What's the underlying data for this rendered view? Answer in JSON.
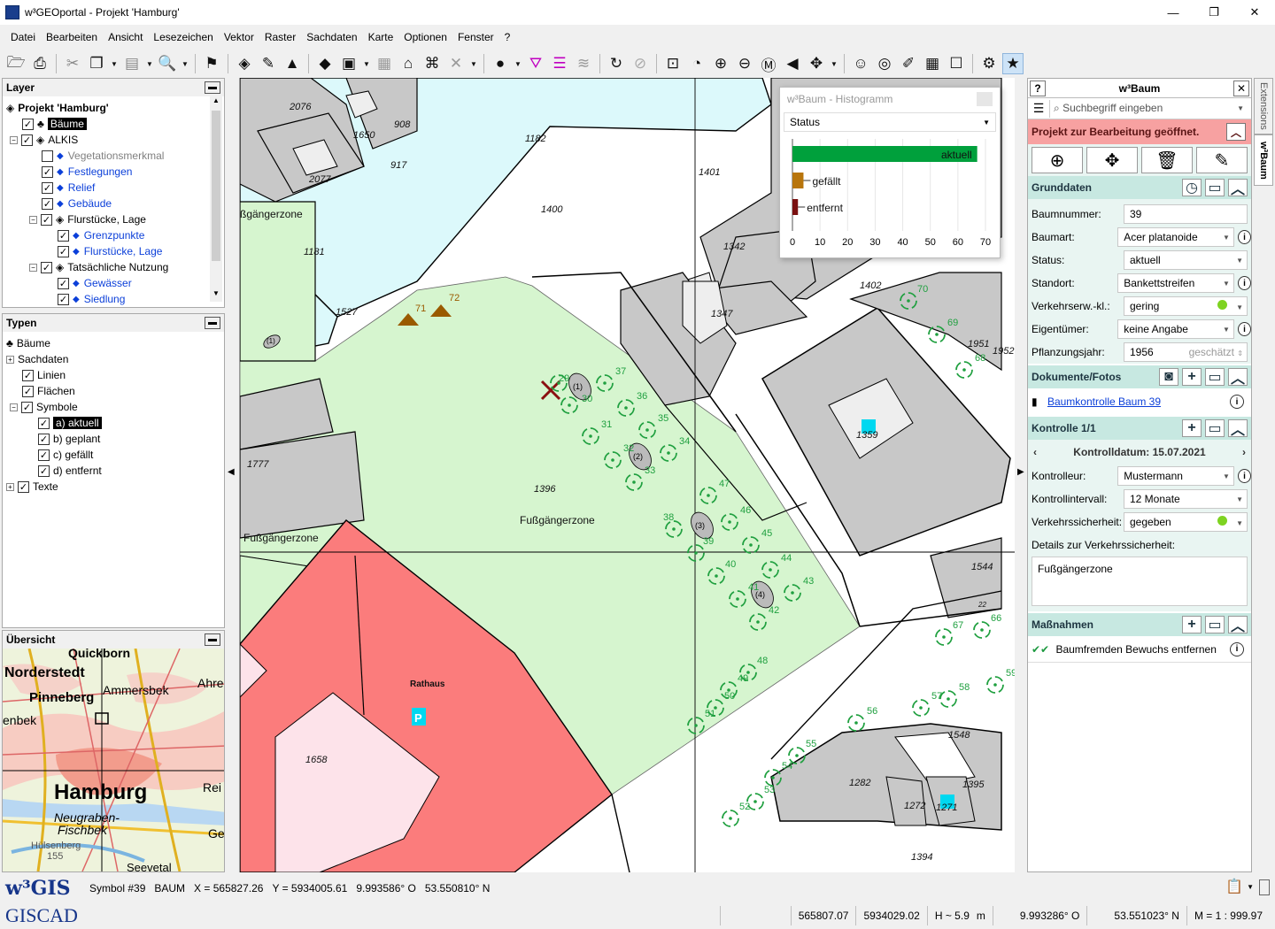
{
  "window": {
    "title": "w³GEOportal - Projekt 'Hamburg'",
    "minimize": "—",
    "maximize": "❐",
    "close": "✕"
  },
  "menu": [
    "Datei",
    "Bearbeiten",
    "Ansicht",
    "Lesezeichen",
    "Vektor",
    "Raster",
    "Sachdaten",
    "Karte",
    "Optionen",
    "Fenster",
    "?"
  ],
  "layer_panel": {
    "title": "Layer",
    "items": [
      {
        "label": "Projekt 'Hamburg'",
        "level": 0,
        "bold": true
      },
      {
        "label": "Bäume",
        "level": 1,
        "checked": true,
        "selected": true
      },
      {
        "label": "ALKIS",
        "level": 1,
        "checked": true
      },
      {
        "label": "Vegetationsmerkmal",
        "level": 2,
        "checked": false,
        "muted": true
      },
      {
        "label": "Festlegungen",
        "level": 2,
        "checked": true
      },
      {
        "label": "Relief",
        "level": 2,
        "checked": true
      },
      {
        "label": "Gebäude",
        "level": 2,
        "checked": true
      },
      {
        "label": "Flurstücke, Lage",
        "level": 2,
        "checked": true
      },
      {
        "label": "Grenzpunkte",
        "level": 3,
        "checked": true
      },
      {
        "label": "Flurstücke, Lage",
        "level": 3,
        "checked": true
      },
      {
        "label": "Tatsächliche Nutzung",
        "level": 2,
        "checked": true
      },
      {
        "label": "Gewässer",
        "level": 3,
        "checked": true
      },
      {
        "label": "Siedlung",
        "level": 3,
        "checked": true
      }
    ]
  },
  "types_panel": {
    "title": "Typen",
    "items": [
      {
        "label": "Bäume",
        "level": 0
      },
      {
        "label": "Sachdaten",
        "level": 0
      },
      {
        "label": "Linien",
        "level": 1,
        "checked": true
      },
      {
        "label": "Flächen",
        "level": 1,
        "checked": true
      },
      {
        "label": "Symbole",
        "level": 1,
        "checked": true
      },
      {
        "label": "a) aktuell",
        "level": 2,
        "checked": true,
        "selected": true
      },
      {
        "label": "b) geplant",
        "level": 2,
        "checked": true
      },
      {
        "label": "c) gefällt",
        "level": 2,
        "checked": true
      },
      {
        "label": "d) entfernt",
        "level": 2,
        "checked": true
      },
      {
        "label": "Texte",
        "level": 0,
        "checked": true
      }
    ]
  },
  "overview_panel": {
    "title": "Übersicht",
    "labels": [
      "Quickborn",
      "Norderstedt",
      "Ammersbek",
      "Ahre",
      "Pinneberg",
      "enbek",
      "Hamburg",
      "Rei",
      "Neugraben-",
      "Fischbek",
      "Hülsenberg",
      "155",
      "Ge",
      "Seevetal"
    ]
  },
  "histogram": {
    "title": "w³Baum - Histogramm",
    "select": "Status",
    "chart_data": {
      "type": "bar",
      "categories": [
        "aktuell",
        "gefällt",
        "entfernt"
      ],
      "values": [
        67,
        4,
        2
      ],
      "colors": [
        "#00a03c",
        "#b8750c",
        "#7a1010"
      ],
      "xlim": [
        0,
        70
      ],
      "xticks": [
        "0",
        "10",
        "20",
        "30",
        "40",
        "50",
        "60",
        "70"
      ]
    }
  },
  "map": {
    "labels": {
      "p2076": "2076",
      "p1650": "1650",
      "p908": "908",
      "p1182": "1182",
      "p917": "917",
      "p2077": "2077",
      "p1400": "1400",
      "p1401": "1401",
      "p1181": "1181",
      "p1527": "1527",
      "p1342": "1342",
      "p1347": "1347",
      "p1402": "1402",
      "p1951": "1951",
      "p1952": "1952-",
      "p1359": "1359",
      "p1777": "1777",
      "p1396": "1396",
      "p1544": "1544",
      "p1658": "1658",
      "p1548": "1548",
      "p1395": "1395",
      "p1282": "1282",
      "p1272": "1272",
      "p1271": "1271",
      "p1394": "1394",
      "p40": "40",
      "p22": "22",
      "fz1": "ßgängerzone",
      "fz2": "Fußgängerzone",
      "fz3": "Fußgängerzone",
      "rathaus": "Rathaus",
      "n1": "(1)",
      "n2": "(2)",
      "n3": "(3)",
      "n4": "(4)",
      "parkP": "P"
    },
    "trees": [
      {
        "n": "37"
      },
      {
        "n": "36"
      },
      {
        "n": "35"
      },
      {
        "n": "34"
      },
      {
        "n": "31"
      },
      {
        "n": "32"
      },
      {
        "n": "33"
      },
      {
        "n": "30"
      },
      {
        "n": "29"
      },
      {
        "n": "47"
      },
      {
        "n": "46"
      },
      {
        "n": "45"
      },
      {
        "n": "44"
      },
      {
        "n": "43"
      },
      {
        "n": "38"
      },
      {
        "n": "39"
      },
      {
        "n": "40"
      },
      {
        "n": "41"
      },
      {
        "n": "42"
      },
      {
        "n": "70"
      },
      {
        "n": "69"
      },
      {
        "n": "68"
      },
      {
        "n": "67"
      },
      {
        "n": "66"
      },
      {
        "n": "59"
      },
      {
        "n": "58"
      },
      {
        "n": "57"
      },
      {
        "n": "56"
      },
      {
        "n": "48"
      },
      {
        "n": "49"
      },
      {
        "n": "50"
      },
      {
        "n": "51"
      },
      {
        "n": "55"
      },
      {
        "n": "54"
      },
      {
        "n": "53"
      },
      {
        "n": "52"
      }
    ],
    "relief": [
      "71",
      "72"
    ]
  },
  "baum_panel": {
    "title": "w³Baum",
    "search_placeholder": "Suchbegriff eingeben",
    "message": "Projekt zur Bearbeitung geöffnet.",
    "grunddaten": {
      "title": "Grunddaten",
      "fields": [
        {
          "label": "Baumnummer:",
          "value": "39"
        },
        {
          "label": "Baumart:",
          "value": "Acer platanoide"
        },
        {
          "label": "Status:",
          "value": "aktuell"
        },
        {
          "label": "Standort:",
          "value": "Bankettstreifen"
        },
        {
          "label": "Verkehrserw.-kl.:",
          "value": "gering"
        },
        {
          "label": "Eigentümer:",
          "value": "keine Angabe"
        },
        {
          "label": "Pflanzungsjahr:",
          "value": "1956",
          "extra": "geschätzt"
        }
      ]
    },
    "dokumente": {
      "title": "Dokumente/Fotos",
      "link": "Baumkontrolle Baum 39"
    },
    "kontrolle": {
      "title": "Kontrolle 1/1",
      "date": "Kontrolldatum: 15.07.2021",
      "fields": [
        {
          "label": "Kontrolleur:",
          "value": "Mustermann"
        },
        {
          "label": "Kontrollintervall:",
          "value": "12 Monate"
        },
        {
          "label": "Verkehrssicherheit:",
          "value": "gegeben"
        }
      ],
      "details_label": "Details zur Verkehrssicherheit:",
      "details_value": "Fußgängerzone"
    },
    "massnahmen": {
      "title": "Maßnahmen",
      "item": "Baumfremden Bewuchs entfernen"
    }
  },
  "side_tabs": [
    "Extensions",
    "w³Baum"
  ],
  "status": {
    "logo1": "w³GIS",
    "logo2": "GISCAD",
    "symbol": "Symbol #39",
    "layer": "BAUM",
    "x": "X = 565827.26",
    "y": "Y = 5934005.61",
    "lon": "9.993586° O",
    "lat": "53.550810° N",
    "c1": "565807.07",
    "c2": "5934029.02",
    "h": "H ~ 5.9",
    "unit": "m",
    "c3": "9.993286° O",
    "c4": "53.551023° N",
    "scale": "M = 1 : 999.97"
  },
  "colors": {
    "accent_teal": "#c7e8e1",
    "message_bg": "#f7a1a1",
    "green_tree": "#20a040",
    "red_parcel": "#fb7c7c",
    "water": "#dcf9fb",
    "park": "#d6f5cf"
  }
}
